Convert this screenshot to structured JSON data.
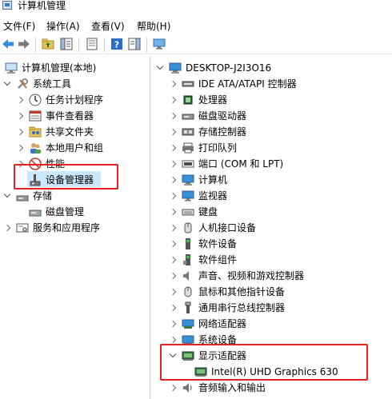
{
  "window": {
    "title": "计算机管理"
  },
  "menu": [
    {
      "label": "文件(F)"
    },
    {
      "label": "操作(A)"
    },
    {
      "label": "查看(V)"
    },
    {
      "label": "帮助(H)"
    }
  ],
  "toolbar": {
    "buttons": [
      "back-arrow-icon",
      "forward-arrow-icon",
      "up-folder-icon",
      "show-hide-tree-icon",
      "properties-icon",
      "help-icon",
      "action-pane-icon",
      "monitor-icon"
    ]
  },
  "left_tree": {
    "root": "计算机管理(本地)",
    "system_tools": "系统工具",
    "task_scheduler": "任务计划程序",
    "event_viewer": "事件查看器",
    "shared_folders": "共享文件夹",
    "local_users": "本地用户和组",
    "performance": "性能",
    "device_manager": "设备管理器",
    "storage": "存储",
    "disk_management": "磁盘管理",
    "services_apps": "服务和应用程序"
  },
  "device_tree": {
    "computer_name": "DESKTOP-J2I3O16",
    "categories": [
      {
        "label": "IDE ATA/ATAPI 控制器",
        "icon": "ide-controller-icon"
      },
      {
        "label": "处理器",
        "icon": "processor-icon"
      },
      {
        "label": "磁盘驱动器",
        "icon": "disk-drive-icon"
      },
      {
        "label": "存储控制器",
        "icon": "storage-controller-icon"
      },
      {
        "label": "打印队列",
        "icon": "printer-icon"
      },
      {
        "label": "端口 (COM 和 LPT)",
        "icon": "port-icon"
      },
      {
        "label": "计算机",
        "icon": "computer-icon"
      },
      {
        "label": "监视器",
        "icon": "monitor-icon"
      },
      {
        "label": "键盘",
        "icon": "keyboard-icon"
      },
      {
        "label": "人机接口设备",
        "icon": "hid-icon"
      },
      {
        "label": "软件设备",
        "icon": "software-device-icon"
      },
      {
        "label": "软件组件",
        "icon": "software-component-icon"
      },
      {
        "label": "声音、视频和游戏控制器",
        "icon": "sound-icon"
      },
      {
        "label": "鼠标和其他指针设备",
        "icon": "mouse-icon"
      },
      {
        "label": "通用串行总线控制器",
        "icon": "usb-icon"
      },
      {
        "label": "网络适配器",
        "icon": "network-adapter-icon"
      },
      {
        "label": "系统设备",
        "icon": "system-device-icon"
      }
    ],
    "display_adapters": "显示适配器",
    "gpu": "Intel(R) UHD Graphics 630",
    "audio_io": "音频输入和输出"
  },
  "colors": {
    "highlight_border": "#e52222",
    "selection": "#cce8ff",
    "accent": "#3b78c4"
  }
}
